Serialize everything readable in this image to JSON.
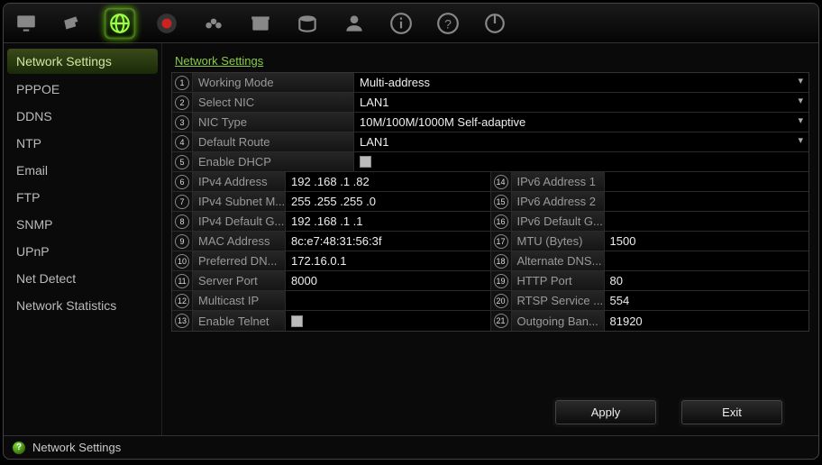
{
  "toolbar_icons": [
    "monitor",
    "camera",
    "network",
    "record",
    "audio",
    "archive",
    "disk",
    "user",
    "info",
    "help",
    "power"
  ],
  "toolbar_active_index": 2,
  "sidebar": {
    "items": [
      {
        "label": "Network Settings"
      },
      {
        "label": "PPPOE"
      },
      {
        "label": "DDNS"
      },
      {
        "label": "NTP"
      },
      {
        "label": "Email"
      },
      {
        "label": "FTP"
      },
      {
        "label": "SNMP"
      },
      {
        "label": "UPnP"
      },
      {
        "label": "Net Detect"
      },
      {
        "label": "Network Statistics"
      }
    ],
    "active_index": 0
  },
  "tab": {
    "label": "Network Settings"
  },
  "rows_full": [
    {
      "n": "1",
      "label": "Working Mode",
      "value": "Multi-address",
      "kind": "select"
    },
    {
      "n": "2",
      "label": "Select NIC",
      "value": "LAN1",
      "kind": "select"
    },
    {
      "n": "3",
      "label": "NIC Type",
      "value": "10M/100M/1000M Self-adaptive",
      "kind": "select"
    },
    {
      "n": "4",
      "label": "Default Route",
      "value": "LAN1",
      "kind": "select"
    },
    {
      "n": "5",
      "label": "Enable DHCP",
      "value": "",
      "kind": "checkbox"
    }
  ],
  "rows_pair": [
    {
      "l": {
        "n": "6",
        "label": "IPv4 Address",
        "value": "192 .168 .1    .82"
      },
      "r": {
        "n": "14",
        "label": "IPv6 Address 1",
        "value": ""
      }
    },
    {
      "l": {
        "n": "7",
        "label": "IPv4 Subnet M...",
        "value": "255 .255 .255 .0"
      },
      "r": {
        "n": "15",
        "label": "IPv6 Address 2",
        "value": ""
      }
    },
    {
      "l": {
        "n": "8",
        "label": "IPv4 Default G...",
        "value": "192 .168 .1    .1"
      },
      "r": {
        "n": "16",
        "label": "IPv6 Default G...",
        "value": ""
      }
    },
    {
      "l": {
        "n": "9",
        "label": "MAC Address",
        "value": "8c:e7:48:31:56:3f"
      },
      "r": {
        "n": "17",
        "label": "MTU (Bytes)",
        "value": "1500"
      }
    },
    {
      "l": {
        "n": "10",
        "label": "Preferred DN...",
        "value": "172.16.0.1"
      },
      "r": {
        "n": "18",
        "label": "Alternate DNS...",
        "value": ""
      }
    },
    {
      "l": {
        "n": "11",
        "label": "Server Port",
        "value": "8000"
      },
      "r": {
        "n": "19",
        "label": "HTTP Port",
        "value": "80"
      }
    },
    {
      "l": {
        "n": "12",
        "label": "Multicast IP",
        "value": ""
      },
      "r": {
        "n": "20",
        "label": "RTSP Service ...",
        "value": "554"
      }
    },
    {
      "l": {
        "n": "13",
        "label": "Enable Telnet",
        "value": "",
        "kind": "checkbox"
      },
      "r": {
        "n": "21",
        "label": "Outgoing Ban...",
        "value": "81920"
      }
    }
  ],
  "footer": {
    "apply": "Apply",
    "exit": "Exit"
  },
  "status": {
    "text": "Network Settings"
  }
}
